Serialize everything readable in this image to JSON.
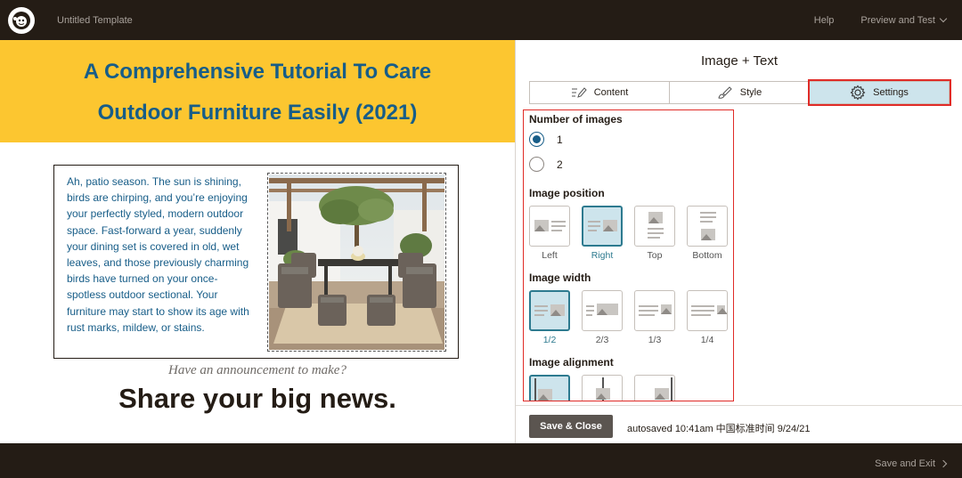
{
  "header": {
    "logo_icon": "monkey-logo-icon",
    "template_title": "Untitled Template",
    "help_label": "Help",
    "preview_label": "Preview and Test"
  },
  "canvas": {
    "hero_line1": "A Comprehensive Tutorial To Care",
    "hero_line2": "Outdoor Furniture Easily (2021)",
    "body_text": "Ah, patio season. The sun is shining, birds are chirping, and you’re enjoying your perfectly styled, modern outdoor space. Fast-forward a year, suddenly your dining set is covered in old, wet leaves, and those previously charming birds have turned on your once-spotless outdoor sectional. Your furniture may start to show its age with rust marks, mildew, or stains.",
    "announcement": "Have an announcement to make?",
    "big_news": "Share your big news."
  },
  "panel": {
    "title": "Image + Text",
    "tabs": [
      {
        "label": "Content",
        "icon": "pencil-icon"
      },
      {
        "label": "Style",
        "icon": "brush-icon"
      },
      {
        "label": "Settings",
        "icon": "gear-icon"
      }
    ],
    "active_tab": "Settings",
    "number_of_images": {
      "label": "Number of images",
      "options": [
        "1",
        "2"
      ],
      "selected": "1"
    },
    "image_position": {
      "label": "Image position",
      "options": [
        "Left",
        "Right",
        "Top",
        "Bottom"
      ],
      "selected": "Right"
    },
    "image_width": {
      "label": "Image width",
      "options": [
        "1/2",
        "2/3",
        "1/3",
        "1/4"
      ],
      "selected": "1/2"
    },
    "image_alignment": {
      "label": "Image alignment"
    },
    "save_close_label": "Save & Close",
    "autosaved_text": "autosaved 10:41am 中国标准时间 9/24/21"
  },
  "footer": {
    "save_exit_label": "Save and Exit"
  },
  "colors": {
    "hero_background": "#fcc630",
    "hero_text": "#175d88",
    "active_tab_background": "#cde4ec",
    "highlight_border": "#e02b27"
  }
}
